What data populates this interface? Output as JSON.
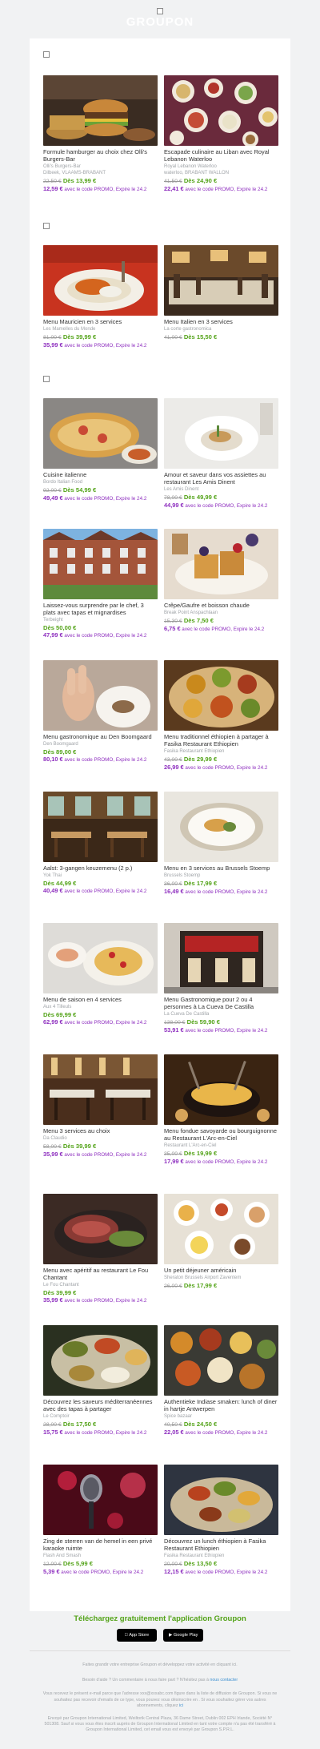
{
  "header": {
    "brand": "GROUPON"
  },
  "sections": [
    {
      "tiles": [
        {
          "title": "Formule hamburger au choix chez Olli's Burgers-Bar",
          "merchant": "Olli's Burgers-Bar",
          "location": "Dilbeek, VLAAMS-BRABANT",
          "old_price": "22,50 €",
          "deal_price": "Dès 13,99 €",
          "promo_price": "12,59 €",
          "promo_text": " avec le code PROMO, Expire le 24.2"
        },
        {
          "title": "Escapade culinaire au Liban avec Royal Lebanon Waterloo",
          "merchant": "Royal Lebanon Waterloo",
          "location": "waterloo, BRABANT WALLON",
          "old_price": "41,50 €",
          "deal_price": "Dès 24,90 €",
          "promo_price": "22,41 €",
          "promo_text": " avec le code PROMO, Expire le 24.2"
        }
      ]
    },
    {
      "tiles": [
        {
          "title": "Menu Mauricien en 3 services",
          "merchant": "Les Mamelles du Monde",
          "old_price": "81,00 €",
          "deal_price": "Dès 39,99 €",
          "promo_price": "35,99 €",
          "promo_text": " avec le code PROMO, Expire le 24.2"
        },
        {
          "title": "Menu Italien en 3 services",
          "merchant": "La corte gastronomica",
          "old_price": "41,00 €",
          "deal_price": "Dès 15,50 €",
          "promo_price": "",
          "promo_text": ""
        }
      ]
    },
    {
      "tiles": [
        {
          "title": "Cuisine italienne",
          "merchant": "Bordo Italian Food",
          "old_price": "92,00 €",
          "deal_price": "Dès 54,99 €",
          "promo_price": "49,49 €",
          "promo_text": " avec le code PROMO, Expire le 24.2"
        },
        {
          "title": "Amour et saveur dans vos assiettes au restaurant Les Amis Dinent",
          "merchant": "Les Amis Dinent",
          "old_price": "78,00 €",
          "deal_price": "Dès 49,99 €",
          "promo_price": "44,99 €",
          "promo_text": " avec le code PROMO, Expire le 24.2"
        },
        {
          "title": "Laissez-vous surprendre par le chef, 3 plats avec tapas et mignardises",
          "merchant": "Terbeight",
          "old_price": "",
          "deal_price": "Dès 50,00 €",
          "promo_price": "47,99 €",
          "promo_text": " avec le code PROMO, Expire le 24.2"
        },
        {
          "title": "Crêpe/Gaufre et boisson chaude",
          "merchant": "Break Point Anspachlaan",
          "old_price": "15,30 €",
          "deal_price": "Dès 7,50 €",
          "promo_price": "6,75 €",
          "promo_text": " avec le code PROMO, Expire le 24.2"
        },
        {
          "title": "Menu gastronomique au Den Boomgaard",
          "merchant": "Den Boomgaard",
          "old_price": "",
          "deal_price": "Dès 89,00 €",
          "promo_price": "80,10 €",
          "promo_text": " avec le code PROMO, Expire le 24.2"
        },
        {
          "title": "Menu traditionnel éthiopien à partager à Fasika Restaurant Ethiopien",
          "merchant": "Fasika Restaurant Ethiopien",
          "old_price": "43,00 €",
          "deal_price": "Dès 29,99 €",
          "promo_price": "26,99 €",
          "promo_text": " avec le code PROMO, Expire le 24.2"
        },
        {
          "title": "Aalst: 3-gangen keuzemenu (2 p.)",
          "merchant": "Yok Thai",
          "old_price": "",
          "deal_price": "Dès 44,99 €",
          "promo_price": "40,49 €",
          "promo_text": " avec le code PROMO, Expire le 24.2"
        },
        {
          "title": "Menu en 3 services au Brussels Stoemp",
          "merchant": "Brussels Stoemp",
          "old_price": "36,00 €",
          "deal_price": "Dès 17,99 €",
          "promo_price": "16,49 €",
          "promo_text": " avec le code PROMO, Expire le 24.2"
        },
        {
          "title": "Menu de saison en 4 services",
          "merchant": "Aux 4 Tilleuls",
          "old_price": "",
          "deal_price": "Dès 69,99 €",
          "promo_price": "62,99 €",
          "promo_text": " avec le code PROMO, Expire le 24.2"
        },
        {
          "title": "Menu Gastronomique pour 2 ou 4 personnes à La Cueva De Castilla",
          "merchant": "La Cueva De Castilla",
          "old_price": "138,00 €",
          "deal_price": "Dès 59,90 €",
          "promo_price": "53,91 €",
          "promo_text": " avec le code PROMO, Expire le 24.2"
        },
        {
          "title": "Menu 3 services au choix",
          "merchant": "Da Claudio",
          "old_price": "58,00 €",
          "deal_price": "Dès 39,99 €",
          "promo_price": "35,99 €",
          "promo_text": " avec le code PROMO, Expire le 24.2"
        },
        {
          "title": "Menu fondue savoyarde ou bourguignonne au Restaurant L'Arc-en-Ciel",
          "merchant": "Restaurant L'Arc-en-Ciel",
          "old_price": "35,00 €",
          "deal_price": "Dès 19,99 €",
          "promo_price": "17,99 €",
          "promo_text": " avec le code PROMO, Expire le 24.2"
        },
        {
          "title": "Menu avec apéritif au restaurant Le Fou Chantant",
          "merchant": "Le Fou Chantant",
          "old_price": "",
          "deal_price": "Dès 39,99 €",
          "promo_price": "35,99 €",
          "promo_text": " avec le code PROMO, Expire le 24.2"
        },
        {
          "title": "Un petit déjeuner américain",
          "merchant": "Sheraton Brussels Airport Zaventem",
          "old_price": "26,00 €",
          "deal_price": "Dès 17,99 €",
          "promo_price": "",
          "promo_text": ""
        },
        {
          "title": "Découvrez les saveurs méditerranéennes avec des tapas à partager",
          "merchant": "Le Comptoir",
          "old_price": "28,00 €",
          "deal_price": "Dès 17,50 €",
          "promo_price": "15,75 €",
          "promo_text": " avec le code PROMO, Expire le 24.2"
        },
        {
          "title": "Authentieke Indiase smaken: lunch of diner in hartje Antwerpen",
          "merchant": "Spice bazaar",
          "old_price": "40,50 €",
          "deal_price": "Dès 24,50 €",
          "promo_price": "22,05 €",
          "promo_text": " avec le code PROMO, Expire le 24.2"
        },
        {
          "title": "Zing de sterren van de hemel in een privé karaoke ruimte",
          "merchant": "Flash And Smash",
          "old_price": "12,00 €",
          "deal_price": "Dès 5,99 €",
          "promo_price": "5,39 €",
          "promo_text": " avec le code PROMO, Expire le 24.2"
        },
        {
          "title": "Découvrez un lunch éthiopien à Fasika Restaurant Ethiopien",
          "merchant": "Fasika Restaurant Ethiopien",
          "old_price": "20,00 €",
          "deal_price": "Dès 13,50 €",
          "promo_price": "12,15 €",
          "promo_text": " avec le code PROMO, Expire le 24.2"
        }
      ]
    }
  ],
  "app_promo": {
    "title": "Téléchargez gratuitement l'application Groupon",
    "app_store": "App Store",
    "google_play": "Google Play"
  },
  "footer": {
    "line1": "Faites grandir votre entreprise Groupon et développez votre activité en cliquant ici.",
    "help_text": "Besoin d'aide ? Un commentaire à nous faire part ? N'hésitez pas à ",
    "help_link": "nous contacter",
    "legal": "Vous recevez le présent e-mail parce que l'adresse xxx@xxxabc.com figure dans la liste de diffusion de Groupon. Si vous ne souhaitez pas recevoir d'emails de ce type, vous pouvez vous désinscrire en . Si vous souhaitez gérer vos autres abonnements, cliquez ",
    "legal_link": "ici",
    "company": "Envoyé par Groupon International Limited, Weiltorik Central Plaza, 36 Dame Street, Dublin 002 EPH Irlande, Société N° 501308. Sauf si vous vous êtes inscrit auprès de Groupon International Limited en tant votre compte n'a pas été transféré à Groupon International Limited, cet email vous est envoyé par Groupon S.P.R.L."
  }
}
